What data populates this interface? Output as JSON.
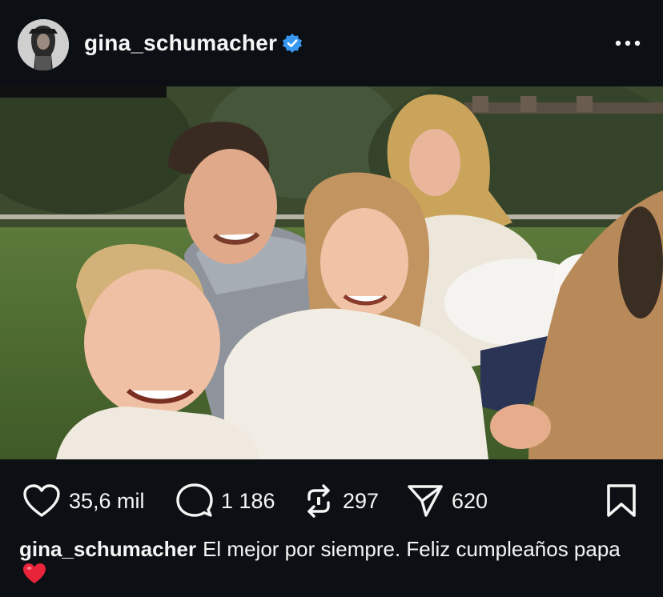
{
  "post": {
    "username": "gina_schumacher",
    "verified": true,
    "more_icon": "ellipsis-icon"
  },
  "media": {
    "type": "photo",
    "description_icon": "family-photo"
  },
  "actions": {
    "likes": "35,6 mil",
    "comments": "1 186",
    "reposts": "297",
    "shares": "620"
  },
  "caption": {
    "username": "gina_schumacher",
    "text": "El mejor por siempre. Feliz cumpleaños papa",
    "emoji": "❤️"
  },
  "colors": {
    "background": "#0c1014",
    "verified": "#3897f0",
    "emoji_heart": "#e8243a"
  }
}
